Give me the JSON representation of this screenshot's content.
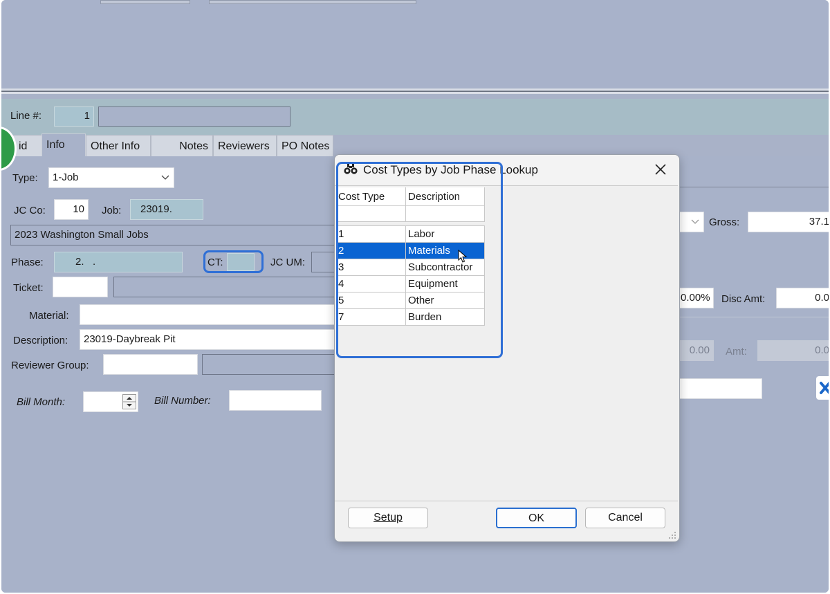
{
  "line": {
    "label": "Line #:",
    "value": "1"
  },
  "tabs": [
    {
      "label": "id"
    },
    {
      "label": "Info"
    },
    {
      "label": "Other Info"
    },
    {
      "label": "Notes"
    },
    {
      "label": "Reviewers"
    },
    {
      "label": "PO Notes"
    }
  ],
  "form": {
    "type_label": "Type:",
    "type_value": "1-Job",
    "jcco_label": "JC Co:",
    "jcco_value": "10",
    "job_label": "Job:",
    "job_value": "23019.",
    "job_desc": "2023 Washington Small Jobs",
    "phase_label": "Phase:",
    "phase_value": "2.   .",
    "ct_label": "CT:",
    "jcum_label": "JC UM:",
    "ticket_label": "Ticket:",
    "material_label": "Material:",
    "description_label": "Description:",
    "description_value": "23019-Daybreak Pit",
    "reviewer_group_label": "Reviewer Group:",
    "bill_month_label": "Bill Month:",
    "bill_number_label": "Bill Number:",
    "gross_label": "Gross:",
    "gross_value": "37.1",
    "disc_pct_value": "0.00%",
    "disc_amt_label": "Disc Amt:",
    "disc_amt_value": "0.0",
    "tax_value": "0.00",
    "amt_label": "Amt:",
    "amt_value": "0.0"
  },
  "dialog": {
    "title": "Cost Types by Job Phase Lookup",
    "columns": [
      "Cost Type",
      "Description"
    ],
    "rows": [
      {
        "code": "1",
        "desc": "Labor"
      },
      {
        "code": "2",
        "desc": "Materials"
      },
      {
        "code": "3",
        "desc": "Subcontractor"
      },
      {
        "code": "4",
        "desc": "Equipment"
      },
      {
        "code": "5",
        "desc": "Other"
      },
      {
        "code": "7",
        "desc": "Burden"
      }
    ],
    "selected_row": "2",
    "setup_label": "Setup",
    "ok_label": "OK",
    "cancel_label": "Cancel"
  },
  "colors": {
    "selection": "#0a64d2",
    "highlight_outline": "#2f6fd6",
    "step_marker": "#2e9b48"
  }
}
